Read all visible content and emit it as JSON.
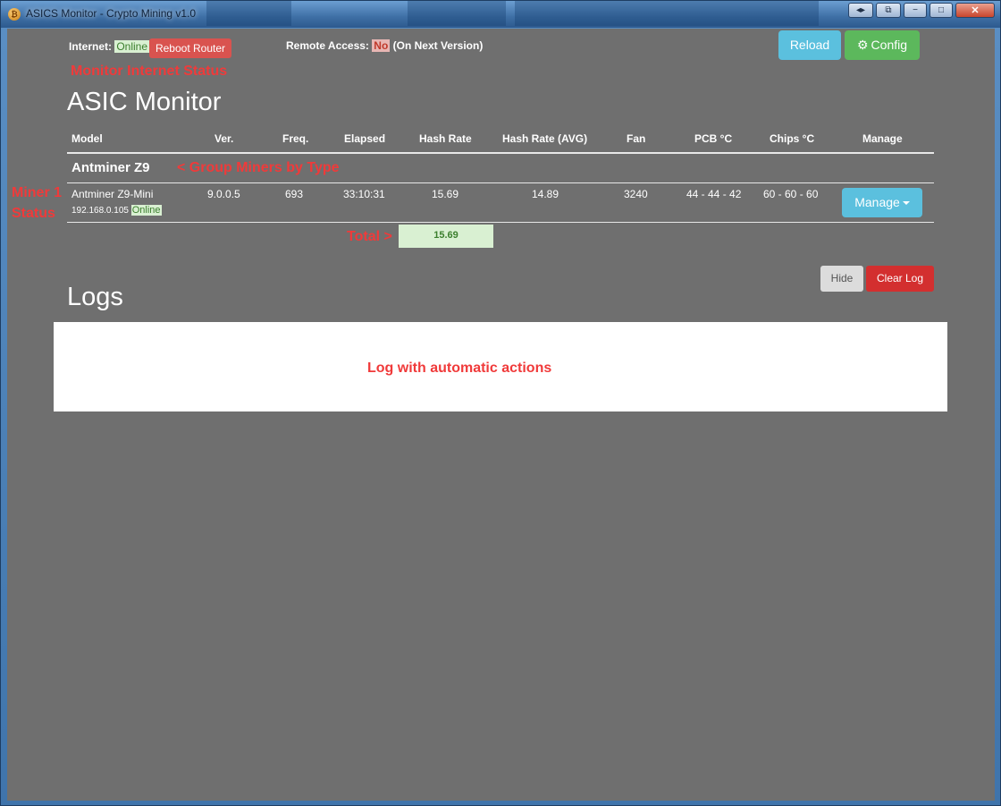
{
  "window": {
    "title": "ASICS Monitor - Crypto Mining v1.0",
    "icon": "bitcoin-icon",
    "controls": {
      "minimize": "−",
      "maximize": "□",
      "close": "✕"
    }
  },
  "status": {
    "internet_label": "Internet:",
    "internet_value": "Online",
    "reboot_label": "Reboot Router",
    "remote_label": "Remote Access:",
    "remote_value": "No",
    "remote_note": "(On Next Version)"
  },
  "toolbar": {
    "reload_label": "Reload",
    "config_label": "Config"
  },
  "annotations": {
    "internet": "Monitor Internet Status",
    "group": "< Group Miners by Type",
    "miner_line1": "Miner 1",
    "miner_line2": "Status",
    "total": "Total >",
    "log": "Log with automatic actions"
  },
  "page_title": "ASIC Monitor",
  "table": {
    "headers": [
      "Model",
      "Ver.",
      "Freq.",
      "Elapsed",
      "Hash Rate",
      "Hash Rate (AVG)",
      "Fan",
      "PCB °C",
      "Chips °C",
      "Manage"
    ],
    "group_name": "Antminer Z9",
    "rows": [
      {
        "model": "Antminer Z9-Mini",
        "ip": "192.168.0.105",
        "status": "Online",
        "version": "9.0.0.5",
        "freq": "693",
        "elapsed": "33:10:31",
        "hash_rate": "15.69",
        "hash_rate_avg": "14.89",
        "fan": "3240",
        "pcb": "44 - 44 - 42",
        "chips": "60 - 60 - 60",
        "manage_label": "Manage"
      }
    ],
    "total": "15.69"
  },
  "logs": {
    "title": "Logs",
    "hide_label": "Hide",
    "clear_label": "Clear Log"
  },
  "colors": {
    "background": "#6f6f6f",
    "accent_info": "#5bc0de",
    "accent_success": "#5cb85c",
    "accent_danger": "#d9534f",
    "annotation": "#f03a3a"
  }
}
